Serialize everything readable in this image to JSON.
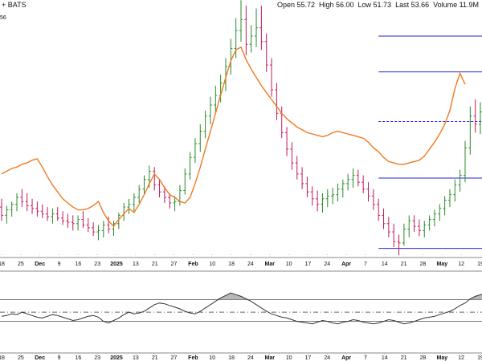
{
  "header": {
    "symbol_text": "+ BATS",
    "ohlc": [
      {
        "key": "Open",
        "value": "55.72"
      },
      {
        "key": "High",
        "value": "56.00"
      },
      {
        "key": "Low",
        "value": "51.73"
      },
      {
        "key": "Last",
        "value": "53.66"
      },
      {
        "key": "Volume",
        "value": "11.9M"
      }
    ],
    "y_tag": "56"
  },
  "colors": {
    "up": "#2a8a2a",
    "down": "#c2185b",
    "ma_line": "#f07a22",
    "level_line": "#2323d6",
    "indicator_line": "#333333",
    "indicator_fill": "#9a9a9a"
  },
  "chart_data": [
    {
      "type": "line",
      "title": "",
      "x_axis_labels": [
        "18",
        "25",
        "Dec",
        "9",
        "16",
        "23",
        "2025",
        "13",
        "21",
        "27",
        "Feb",
        "10",
        "18",
        "24",
        "Mar",
        "10",
        "17",
        "24",
        "Apr",
        "7",
        "14",
        "21",
        "28",
        "May",
        "12",
        "19"
      ],
      "bold_labels": [
        "Dec",
        "2025",
        "Feb",
        "Mar",
        "Apr",
        "May"
      ],
      "series": [
        {
          "values": [
            56.0,
            56.2,
            56.4,
            56.5,
            56.7,
            56.8,
            57.0,
            57.1,
            56.5,
            55.8,
            55.2,
            54.7,
            54.2,
            53.9,
            53.6,
            53.4,
            53.4,
            53.5,
            53.7,
            54.0,
            53.2,
            52.6,
            52.2,
            52.7,
            53.1,
            53.5,
            53.2,
            53.8,
            54.5,
            55.3,
            56.0,
            55.6,
            55.0,
            54.5,
            54.3,
            54.0,
            53.9,
            54.3,
            55.3,
            56.5,
            57.8,
            59.1,
            60.4,
            61.7,
            63.0,
            64.2,
            65.0,
            65.2,
            64.3,
            63.6,
            63.0,
            62.4,
            61.9,
            61.4,
            60.9,
            60.4,
            60.0,
            59.7,
            59.4,
            59.2,
            59.0,
            58.9,
            58.8,
            58.7,
            58.8,
            59.0,
            59.1,
            59.0,
            58.9,
            58.8,
            58.7,
            58.6,
            58.3,
            57.9,
            57.6,
            57.2,
            56.9,
            56.8,
            56.7,
            56.7,
            56.8,
            56.9,
            57.0,
            57.3,
            57.8,
            58.3,
            58.9,
            59.6,
            60.6,
            62.2,
            63.3,
            62.5
          ]
        }
      ],
      "bars": [
        {
          "o": 53.6,
          "h": 54.2,
          "l": 52.6,
          "c": 53.0
        },
        {
          "o": 53.0,
          "h": 53.7,
          "l": 52.4,
          "c": 53.4
        },
        {
          "o": 53.4,
          "h": 54.0,
          "l": 52.9,
          "c": 53.8
        },
        {
          "o": 53.8,
          "h": 54.6,
          "l": 53.3,
          "c": 54.3
        },
        {
          "o": 54.3,
          "h": 54.9,
          "l": 53.6,
          "c": 54.0
        },
        {
          "o": 54.0,
          "h": 54.6,
          "l": 53.3,
          "c": 53.7
        },
        {
          "o": 53.7,
          "h": 54.2,
          "l": 53.1,
          "c": 53.5
        },
        {
          "o": 53.5,
          "h": 54.0,
          "l": 52.9,
          "c": 53.3
        },
        {
          "o": 53.3,
          "h": 53.8,
          "l": 52.8,
          "c": 53.1
        },
        {
          "o": 53.1,
          "h": 53.6,
          "l": 52.6,
          "c": 52.9
        },
        {
          "o": 52.9,
          "h": 53.5,
          "l": 52.4,
          "c": 53.1
        },
        {
          "o": 53.1,
          "h": 53.6,
          "l": 52.6,
          "c": 52.8
        },
        {
          "o": 52.8,
          "h": 53.3,
          "l": 52.3,
          "c": 52.6
        },
        {
          "o": 52.6,
          "h": 53.1,
          "l": 52.1,
          "c": 52.5
        },
        {
          "o": 52.5,
          "h": 53.0,
          "l": 51.9,
          "c": 52.4
        },
        {
          "o": 52.4,
          "h": 53.0,
          "l": 51.9,
          "c": 52.7
        },
        {
          "o": 52.7,
          "h": 53.3,
          "l": 52.1,
          "c": 52.3
        },
        {
          "o": 52.3,
          "h": 52.8,
          "l": 51.8,
          "c": 52.1
        },
        {
          "o": 52.1,
          "h": 52.5,
          "l": 51.5,
          "c": 51.8
        },
        {
          "o": 51.8,
          "h": 52.3,
          "l": 51.2,
          "c": 51.9
        },
        {
          "o": 51.9,
          "h": 52.6,
          "l": 51.4,
          "c": 52.3
        },
        {
          "o": 52.3,
          "h": 52.9,
          "l": 51.7,
          "c": 52.0
        },
        {
          "o": 52.0,
          "h": 52.6,
          "l": 51.5,
          "c": 52.4
        },
        {
          "o": 52.4,
          "h": 53.2,
          "l": 52.0,
          "c": 53.0
        },
        {
          "o": 53.0,
          "h": 53.9,
          "l": 52.6,
          "c": 53.6
        },
        {
          "o": 53.6,
          "h": 54.2,
          "l": 53.1,
          "c": 53.8
        },
        {
          "o": 53.8,
          "h": 54.6,
          "l": 53.3,
          "c": 54.3
        },
        {
          "o": 54.3,
          "h": 55.2,
          "l": 53.9,
          "c": 54.9
        },
        {
          "o": 54.9,
          "h": 55.9,
          "l": 54.5,
          "c": 55.6
        },
        {
          "o": 55.6,
          "h": 56.6,
          "l": 55.0,
          "c": 56.2
        },
        {
          "o": 56.2,
          "h": 56.5,
          "l": 54.8,
          "c": 55.2
        },
        {
          "o": 55.2,
          "h": 55.6,
          "l": 54.3,
          "c": 54.7
        },
        {
          "o": 54.7,
          "h": 55.1,
          "l": 53.9,
          "c": 54.3
        },
        {
          "o": 54.3,
          "h": 54.6,
          "l": 53.5,
          "c": 53.9
        },
        {
          "o": 53.9,
          "h": 54.4,
          "l": 53.3,
          "c": 54.0
        },
        {
          "o": 54.0,
          "h": 55.2,
          "l": 53.7,
          "c": 54.8
        },
        {
          "o": 54.8,
          "h": 56.4,
          "l": 54.5,
          "c": 56.0
        },
        {
          "o": 56.0,
          "h": 57.6,
          "l": 55.6,
          "c": 57.2
        },
        {
          "o": 57.2,
          "h": 58.6,
          "l": 56.8,
          "c": 58.2
        },
        {
          "o": 58.2,
          "h": 59.6,
          "l": 57.6,
          "c": 59.1
        },
        {
          "o": 59.1,
          "h": 60.6,
          "l": 58.6,
          "c": 60.2
        },
        {
          "o": 60.2,
          "h": 61.6,
          "l": 59.6,
          "c": 61.0
        },
        {
          "o": 61.0,
          "h": 62.4,
          "l": 60.4,
          "c": 61.7
        },
        {
          "o": 61.7,
          "h": 63.2,
          "l": 61.2,
          "c": 62.6
        },
        {
          "o": 62.6,
          "h": 64.4,
          "l": 62.0,
          "c": 63.8
        },
        {
          "o": 63.8,
          "h": 65.8,
          "l": 63.2,
          "c": 65.1
        },
        {
          "o": 65.1,
          "h": 67.3,
          "l": 64.4,
          "c": 66.4
        },
        {
          "o": 66.4,
          "h": 68.6,
          "l": 65.6,
          "c": 67.2
        },
        {
          "o": 67.2,
          "h": 68.2,
          "l": 64.6,
          "c": 65.4
        },
        {
          "o": 65.4,
          "h": 66.8,
          "l": 64.8,
          "c": 66.0
        },
        {
          "o": 66.0,
          "h": 68.0,
          "l": 65.2,
          "c": 66.6
        },
        {
          "o": 66.6,
          "h": 68.2,
          "l": 65.0,
          "c": 65.6
        },
        {
          "o": 65.6,
          "h": 66.2,
          "l": 63.4,
          "c": 63.9
        },
        {
          "o": 63.9,
          "h": 64.4,
          "l": 61.6,
          "c": 62.1
        },
        {
          "o": 62.1,
          "h": 62.6,
          "l": 59.9,
          "c": 60.4
        },
        {
          "o": 60.4,
          "h": 60.9,
          "l": 58.6,
          "c": 59.0
        },
        {
          "o": 59.0,
          "h": 59.4,
          "l": 57.3,
          "c": 57.8
        },
        {
          "o": 57.8,
          "h": 58.3,
          "l": 56.3,
          "c": 56.8
        },
        {
          "o": 56.8,
          "h": 57.3,
          "l": 55.6,
          "c": 56.0
        },
        {
          "o": 56.0,
          "h": 56.5,
          "l": 54.9,
          "c": 55.3
        },
        {
          "o": 55.3,
          "h": 55.8,
          "l": 54.3,
          "c": 54.7
        },
        {
          "o": 54.7,
          "h": 55.1,
          "l": 53.7,
          "c": 54.2
        },
        {
          "o": 54.2,
          "h": 54.8,
          "l": 53.3,
          "c": 53.8
        },
        {
          "o": 53.8,
          "h": 54.6,
          "l": 53.2,
          "c": 54.2
        },
        {
          "o": 54.2,
          "h": 54.9,
          "l": 53.6,
          "c": 54.4
        },
        {
          "o": 54.4,
          "h": 55.0,
          "l": 53.8,
          "c": 54.5
        },
        {
          "o": 54.5,
          "h": 55.3,
          "l": 54.0,
          "c": 54.9
        },
        {
          "o": 54.9,
          "h": 55.6,
          "l": 54.3,
          "c": 55.3
        },
        {
          "o": 55.3,
          "h": 56.0,
          "l": 54.8,
          "c": 55.6
        },
        {
          "o": 55.6,
          "h": 56.4,
          "l": 55.0,
          "c": 55.9
        },
        {
          "o": 55.9,
          "h": 56.3,
          "l": 55.1,
          "c": 55.4
        },
        {
          "o": 55.4,
          "h": 55.9,
          "l": 54.6,
          "c": 54.9
        },
        {
          "o": 54.9,
          "h": 55.4,
          "l": 54.0,
          "c": 54.4
        },
        {
          "o": 54.4,
          "h": 54.9,
          "l": 53.4,
          "c": 53.8
        },
        {
          "o": 53.8,
          "h": 54.2,
          "l": 52.6,
          "c": 53.0
        },
        {
          "o": 53.0,
          "h": 53.5,
          "l": 52.0,
          "c": 52.4
        },
        {
          "o": 52.4,
          "h": 52.9,
          "l": 51.4,
          "c": 51.8
        },
        {
          "o": 51.8,
          "h": 52.4,
          "l": 50.7,
          "c": 51.1
        },
        {
          "o": 51.1,
          "h": 51.6,
          "l": 50.1,
          "c": 51.0
        },
        {
          "o": 51.0,
          "h": 52.4,
          "l": 50.8,
          "c": 52.0
        },
        {
          "o": 52.0,
          "h": 53.0,
          "l": 51.4,
          "c": 52.6
        },
        {
          "o": 52.6,
          "h": 53.0,
          "l": 51.8,
          "c": 52.2
        },
        {
          "o": 52.2,
          "h": 52.7,
          "l": 51.5,
          "c": 51.9
        },
        {
          "o": 51.9,
          "h": 52.6,
          "l": 51.4,
          "c": 52.3
        },
        {
          "o": 52.3,
          "h": 53.0,
          "l": 51.9,
          "c": 52.7
        },
        {
          "o": 52.7,
          "h": 53.4,
          "l": 52.2,
          "c": 53.1
        },
        {
          "o": 53.1,
          "h": 53.8,
          "l": 52.6,
          "c": 53.5
        },
        {
          "o": 53.5,
          "h": 54.4,
          "l": 53.0,
          "c": 54.1
        },
        {
          "o": 54.1,
          "h": 54.9,
          "l": 53.6,
          "c": 54.5
        },
        {
          "o": 54.5,
          "h": 55.6,
          "l": 54.0,
          "c": 55.2
        },
        {
          "o": 55.2,
          "h": 56.3,
          "l": 54.7,
          "c": 55.9
        },
        {
          "o": 55.9,
          "h": 58.4,
          "l": 55.4,
          "c": 57.9
        },
        {
          "o": 57.9,
          "h": 60.9,
          "l": 57.4,
          "c": 60.2
        },
        {
          "o": 60.2,
          "h": 61.4,
          "l": 59.0,
          "c": 59.6
        },
        {
          "o": 59.6,
          "h": 61.2,
          "l": 58.9,
          "c": 60.5
        }
      ],
      "levels": [
        {
          "value": 66.0,
          "style": "solid"
        },
        {
          "value": 63.4,
          "style": "solid"
        },
        {
          "value": 59.8,
          "style": "dashed"
        },
        {
          "value": 55.7,
          "style": "solid"
        },
        {
          "value": 50.6,
          "style": "solid"
        }
      ],
      "ylim": [
        50.0,
        67.8
      ]
    },
    {
      "type": "area",
      "title": "",
      "values": [
        42,
        43,
        45,
        44,
        47,
        45,
        43,
        41,
        40,
        42,
        44,
        43,
        41,
        39,
        37,
        38,
        40,
        42,
        43,
        41,
        36,
        34,
        37,
        40,
        44,
        47,
        45,
        46,
        48,
        52,
        56,
        58,
        57,
        55,
        53,
        51,
        48,
        46,
        45,
        48,
        52,
        56,
        60,
        64,
        67,
        70,
        68,
        66,
        63,
        60,
        56,
        52,
        48,
        45,
        43,
        41,
        40,
        38,
        36,
        35,
        34,
        33,
        35,
        37,
        36,
        34,
        33,
        35,
        36,
        38,
        37,
        35,
        34,
        33,
        34,
        36,
        38,
        37,
        35,
        33,
        34,
        36,
        38,
        40,
        41,
        42,
        44,
        46,
        48,
        51,
        55,
        58,
        63,
        66,
        68,
        69
      ],
      "ylim": [
        25,
        75
      ],
      "reference_levels": [
        62,
        47,
        36
      ]
    }
  ]
}
